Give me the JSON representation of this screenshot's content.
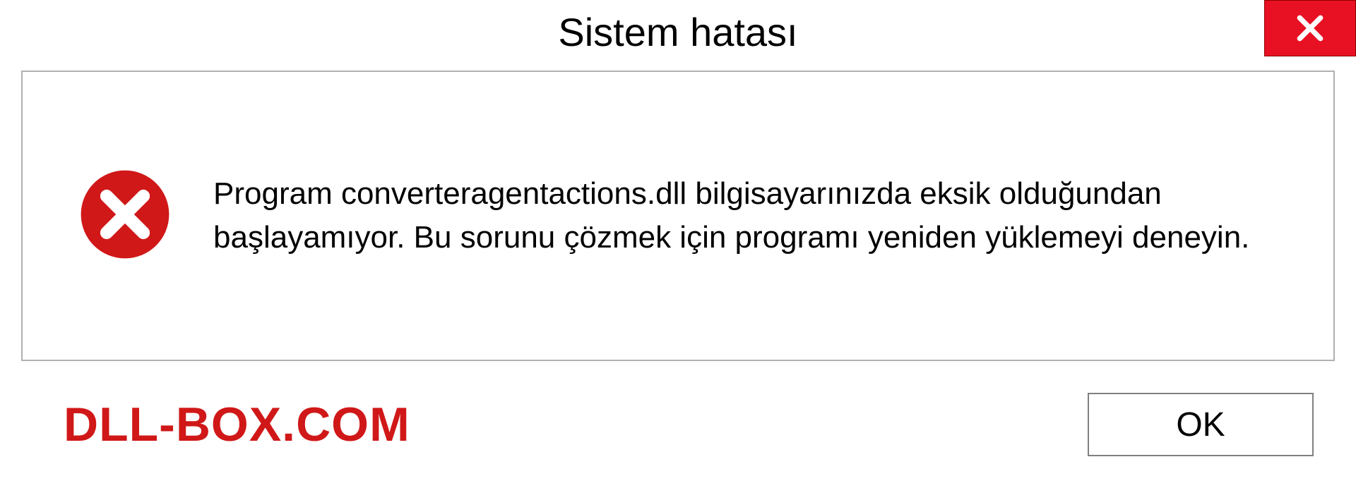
{
  "dialog": {
    "title": "Sistem hatası",
    "message": "Program converteragentactions.dll bilgisayarınızda eksik olduğundan başlayamıyor. Bu sorunu çözmek için programı yeniden yüklemeyi deneyin.",
    "ok_label": "OK",
    "watermark": "DLL-BOX.COM"
  }
}
